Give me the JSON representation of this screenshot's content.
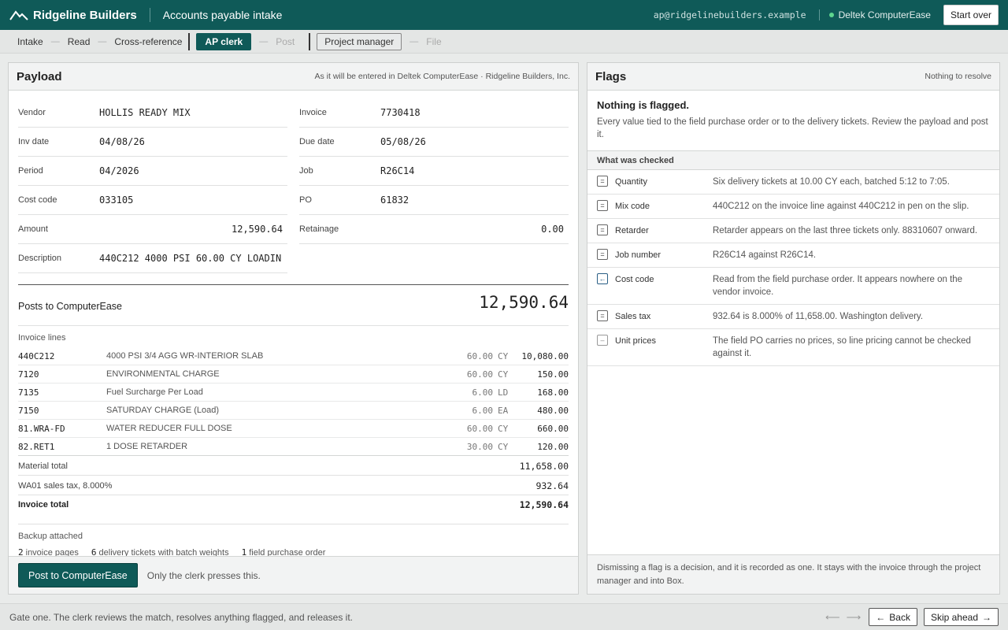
{
  "topbar": {
    "brand": "Ridgeline Builders",
    "app_title": "Accounts payable intake",
    "email": "ap@ridgelinebuilders.example",
    "system": "Deltek ComputerEase",
    "start_over": "Start over"
  },
  "steps": {
    "intake": "Intake",
    "read": "Read",
    "crossref": "Cross-reference",
    "ap_clerk": "AP clerk",
    "post": "Post",
    "project_manager": "Project manager",
    "file": "File",
    "dash": "—"
  },
  "payload": {
    "title": "Payload",
    "note": "As it will be entered in Deltek ComputerEase · Ridgeline Builders, Inc.",
    "fields": {
      "vendor_label": "Vendor",
      "vendor": "HOLLIS READY MIX",
      "invoice_label": "Invoice",
      "invoice": "7730418",
      "inv_date_label": "Inv date",
      "inv_date": "04/08/26",
      "due_date_label": "Due date",
      "due_date": "05/08/26",
      "period_label": "Period",
      "period": "04/2026",
      "job_label": "Job",
      "job": "R26C14",
      "cost_code_label": "Cost code",
      "cost_code": "033105",
      "po_label": "PO",
      "po": "61832",
      "amount_label": "Amount",
      "amount": "12,590.64",
      "retainage_label": "Retainage",
      "retainage": "0.00",
      "description_label": "Description",
      "description": "440C212 4000 PSI 60.00 CY LOADIN"
    },
    "posts_label": "Posts to ComputerEase",
    "posts_amount": "12,590.64",
    "lines_heading": "Invoice lines",
    "lines": [
      {
        "code": "440C212",
        "desc": "4000 PSI 3/4 AGG WR-INTERIOR SLAB",
        "qty": "60.00",
        "unit": "CY",
        "amount": "10,080.00"
      },
      {
        "code": "7120",
        "desc": "ENVIRONMENTAL CHARGE",
        "qty": "60.00",
        "unit": "CY",
        "amount": "150.00"
      },
      {
        "code": "7135",
        "desc": "Fuel Surcharge Per Load",
        "qty": "6.00",
        "unit": "LD",
        "amount": "168.00"
      },
      {
        "code": "7150",
        "desc": "SATURDAY CHARGE (Load)",
        "qty": "6.00",
        "unit": "EA",
        "amount": "480.00"
      },
      {
        "code": "81.WRA-FD",
        "desc": "WATER REDUCER FULL DOSE",
        "qty": "60.00",
        "unit": "CY",
        "amount": "660.00"
      },
      {
        "code": "82.RET1",
        "desc": "1 DOSE RETARDER",
        "qty": "30.00",
        "unit": "CY",
        "amount": "120.00"
      }
    ],
    "material_total_label": "Material total",
    "material_total": "11,658.00",
    "tax_label": "WA01 sales tax, 8.000%",
    "tax": "932.64",
    "invoice_total_label": "Invoice total",
    "invoice_total": "12,590.64",
    "backup_heading": "Backup attached",
    "backup": [
      {
        "n": "2",
        "label": "invoice pages"
      },
      {
        "n": "6",
        "label": "delivery tickets with batch weights"
      },
      {
        "n": "1",
        "label": "field purchase order"
      }
    ],
    "post_button": "Post to ComputerEase",
    "post_note": "Only the clerk presses this."
  },
  "flags": {
    "title": "Flags",
    "status": "Nothing to resolve",
    "nothing_title": "Nothing is flagged.",
    "nothing_body": "Every value tied to the field purchase order or to the delivery tickets. Review the payload and post it.",
    "checked_heading": "What was checked",
    "checks": [
      {
        "icon": "=",
        "name": "Quantity",
        "desc": "Six delivery tickets at 10.00 CY each, batched 5:12 to 7:05."
      },
      {
        "icon": "=",
        "name": "Mix code",
        "desc": "440C212 on the invoice line against 440C212 in pen on the slip."
      },
      {
        "icon": "=",
        "name": "Retarder",
        "desc": "Retarder appears on the last three tickets only. 88310607 onward."
      },
      {
        "icon": "=",
        "name": "Job number",
        "desc": "R26C14 against R26C14."
      },
      {
        "icon": "←",
        "name": "Cost code",
        "desc": "Read from the field purchase order. It appears nowhere on the vendor invoice."
      },
      {
        "icon": "=",
        "name": "Sales tax",
        "desc": "932.64 is 8.000% of 11,658.00. Washington delivery."
      },
      {
        "icon": "–",
        "name": "Unit prices",
        "desc": "The field PO carries no prices, so line pricing cannot be checked against it."
      }
    ],
    "footer": "Dismissing a flag is a decision, and it is recorded as one. It stays with the invoice through the project manager and into Box."
  },
  "bottombar": {
    "note": "Gate one. The clerk reviews the match, resolves anything flagged, and releases it.",
    "back": "Back",
    "skip": "Skip ahead"
  },
  "colors": {
    "brand": "#0f5a58",
    "accent_dot": "#5ed68f",
    "arrow_icon": "#2a5f85"
  },
  "icons": {
    "logo": "mountain-logo-icon",
    "back": "arrow-left-icon",
    "skip": "arrow-right-icon",
    "prev": "arrow-left-icon",
    "next": "arrow-right-icon"
  }
}
